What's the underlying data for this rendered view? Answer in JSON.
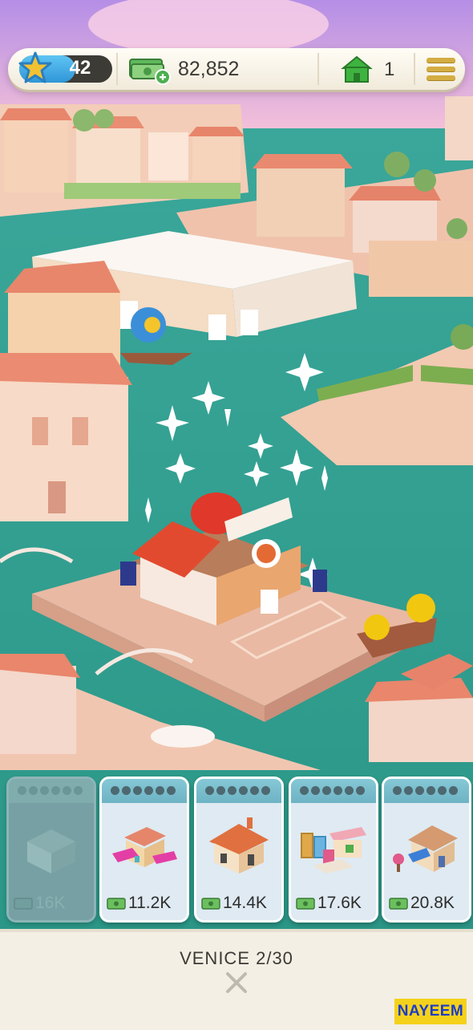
{
  "hud": {
    "level": "42",
    "level_progress": 0.6,
    "money": "82,852",
    "houses": "1"
  },
  "cards": [
    {
      "price": "16K",
      "locked": true,
      "icon": "building-icon"
    },
    {
      "price": "11.2K",
      "locked": false,
      "icon": "market-house-icon"
    },
    {
      "price": "14.4K",
      "locked": false,
      "icon": "villa-icon"
    },
    {
      "price": "17.6K",
      "locked": false,
      "icon": "art-stall-icon"
    },
    {
      "price": "20.8K",
      "locked": false,
      "icon": "cottage-icon"
    }
  ],
  "panel": {
    "city": "VENICE 2/30"
  },
  "watermark": "NAYEEM",
  "colors": {
    "water": "#2f9c8d",
    "hud_accent": "#2f96d8",
    "money_green": "#4caf50",
    "house_green": "#3fb33f",
    "menu_gold": "#d4ad42",
    "roof": "#e8836b",
    "watermark_bg": "#f4d21b"
  }
}
